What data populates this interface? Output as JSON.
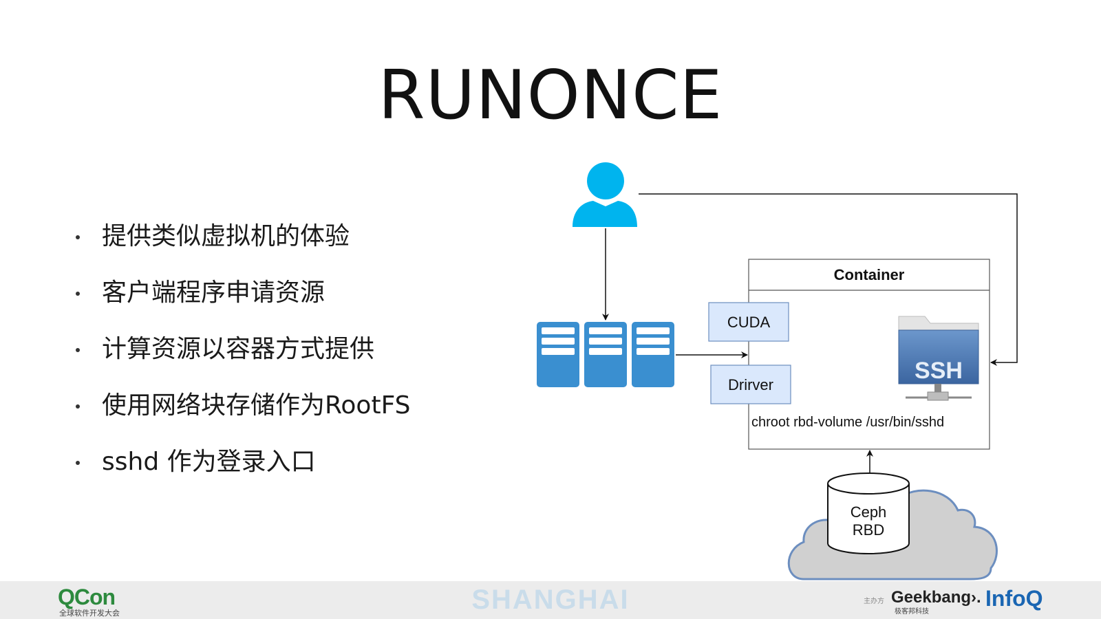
{
  "title": "RUNONCE",
  "bullets": [
    "提供类似虚拟机的体验",
    "客户端程序申请资源",
    "计算资源以容器方式提供",
    "使用网络块存储作为RootFS",
    "sshd 作为登录入口"
  ],
  "diagram": {
    "container_title": "Container",
    "cuda_label": "CUDA",
    "driver_label": "Drirver",
    "ssh_label": "SSH",
    "chroot_command": "chroot rbd-volume /usr/bin/sshd",
    "ceph_line1": "Ceph",
    "ceph_line2": "RBD",
    "icons": [
      "user-icon",
      "server-rack-icon",
      "ssh-folder-icon",
      "database-cylinder-icon",
      "cloud-icon"
    ]
  },
  "footer": {
    "qcon": "QCon",
    "qcon_sub": "全球软件开发大会",
    "city": "SHANGHAI",
    "sponsor_label": "主办方",
    "geekbang": "Geekbang›.",
    "geekbang_sub": "极客邦科技",
    "infoq": "InfoQ"
  },
  "colors": {
    "user_icon": "#00b4ee",
    "server": "#3a8fd0",
    "box_fill": "#dae8fc",
    "box_stroke": "#6c8ebf",
    "cloud_fill": "#d0d0d0",
    "cloud_stroke": "#6c8ebf",
    "ssh_blue": "#4a77b0"
  }
}
